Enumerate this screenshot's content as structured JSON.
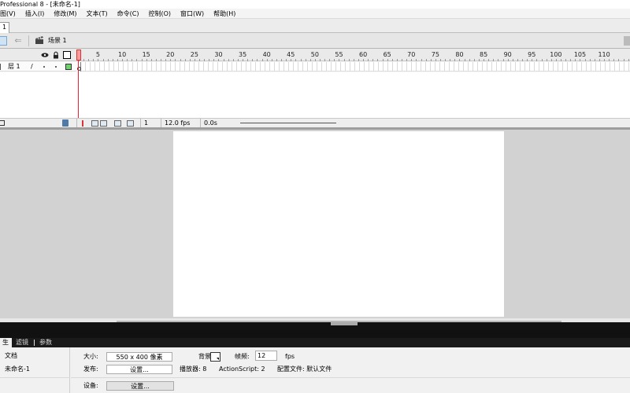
{
  "window": {
    "title": "Professional 8 - [未命名-1]"
  },
  "menu": [
    {
      "id": "view",
      "label": "图(V)"
    },
    {
      "id": "insert",
      "label": "插入(I)"
    },
    {
      "id": "modify",
      "label": "修改(M)"
    },
    {
      "id": "text",
      "label": "文本(T)"
    },
    {
      "id": "commands",
      "label": "命令(C)"
    },
    {
      "id": "control",
      "label": "控制(O)"
    },
    {
      "id": "window",
      "label": "窗口(W)"
    },
    {
      "id": "help",
      "label": "帮助(H)"
    }
  ],
  "doc_tab": {
    "label": "1"
  },
  "scene_bar": {
    "scene_label": "场景 1",
    "back_icon": "back-arrow-icon",
    "scene_icon": "clapper-icon"
  },
  "timeline": {
    "header_icons": [
      "eye-icon",
      "lock-icon",
      "outline-icon"
    ],
    "frame_ticks": [
      "5",
      "10",
      "15",
      "20",
      "25",
      "30",
      "35",
      "40",
      "45",
      "50",
      "55",
      "60",
      "65",
      "70",
      "75",
      "80",
      "85",
      "90",
      "95",
      "100",
      "105",
      "110",
      "1"
    ],
    "layer": {
      "name": "层 1",
      "edit_icon": "pencil-icon",
      "color": "#6fd26f"
    },
    "footer": {
      "current_frame": "1",
      "frame_rate": "12.0 fps",
      "elapsed_time": "0.0s"
    }
  },
  "properties": {
    "tabs": {
      "properties": "生",
      "filters": "滤镜",
      "parameters": "参数"
    },
    "document_type": "文档",
    "document_name": "未命名-1",
    "size_label": "大小:",
    "size_value": "550 x 400 像素",
    "background_label": "背景:",
    "background_color": "#ffffff",
    "frame_rate_label": "帧频:",
    "frame_rate_value": "12",
    "frame_rate_unit": "fps",
    "publish_label": "发布:",
    "publish_button": "设置...",
    "player_label": "播放器: 8",
    "actionscript_label": "ActionScript: 2",
    "profile_label": "配置文件: 默认文件",
    "devices_label": "设备:",
    "devices_button": "设置..."
  }
}
